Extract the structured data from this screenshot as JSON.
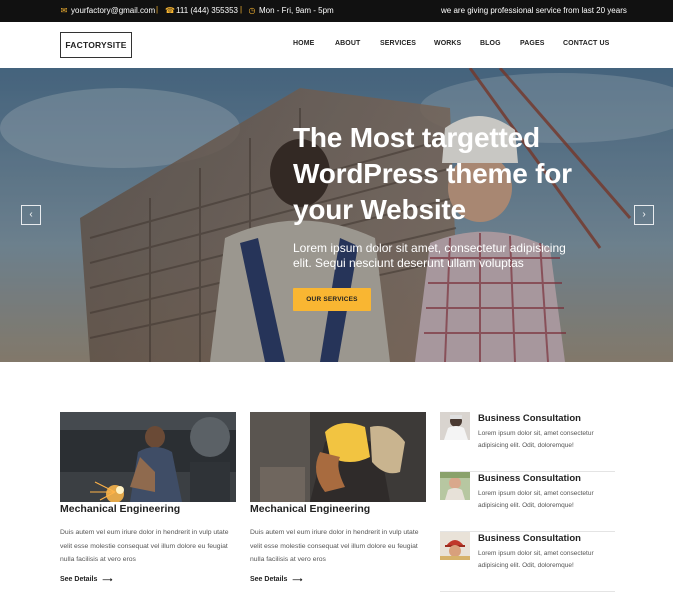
{
  "topbar": {
    "email": "yourfactory@gmail.com",
    "phone": "111 (444) 355353",
    "hours": "Mon - Fri, 9am - 5pm",
    "tagline": "we are giving professional service from last 20 years",
    "accent": "#f9b632"
  },
  "header": {
    "logo": "FACTORYSITE",
    "nav": [
      "HOME",
      "ABOUT",
      "SERVICES",
      "WORKS",
      "BLOG",
      "PAGES",
      "CONTACT US"
    ]
  },
  "hero": {
    "title": "The Most targetted WordPress theme for your Website",
    "subtitle": "Lorem ipsum dolor sit amet, consectetur adipisicing elit. Sequi nesciunt deserunt ullam voluptas",
    "button": "OUR SERVICES",
    "prev_icon": "‹",
    "next_icon": "›"
  },
  "services": [
    {
      "title": "Mechanical Engineering",
      "text": "Duis autem vel eum iriure dolor in hendrerit in vulp utate velit esse molestie consequat vel illum dolore eu feugiat nulla facilisis at vero eros",
      "link": "See Details"
    },
    {
      "title": "Mechanical Engineering",
      "text": "Duis autem vel eum iriure dolor in hendrerit in vulp utate velit esse molestie consequat vel illum dolore eu feugiat nulla facilisis at vero eros",
      "link": "See Details"
    }
  ],
  "sidebar": [
    {
      "title": "Business Consultation",
      "text": "Lorem ipsum dolor sit, amet consectetur adipisicing elit. Odit, doloremque!"
    },
    {
      "title": "Business Consultation",
      "text": "Lorem ipsum dolor sit, amet consectetur adipisicing elit. Odit, doloremque!"
    },
    {
      "title": "Business Consultation",
      "text": "Lorem ipsum dolor sit, amet consectetur adipisicing elit. Odit, doloremque!"
    }
  ]
}
